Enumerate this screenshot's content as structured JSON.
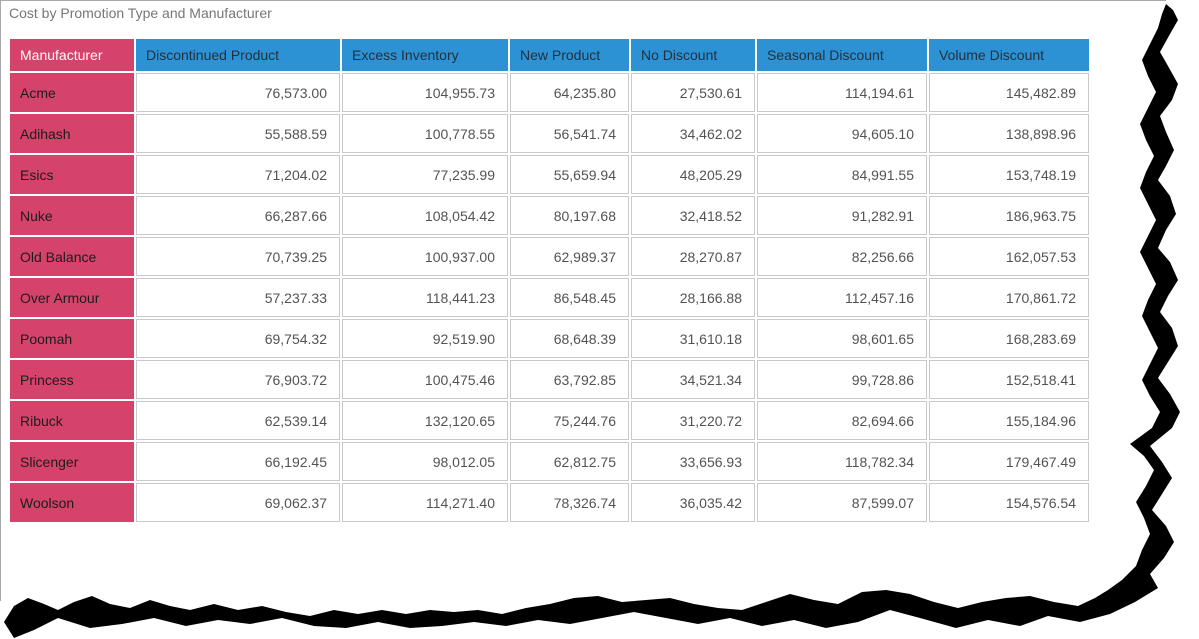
{
  "title": "Cost by Promotion Type and Manufacturer",
  "chart_data": {
    "type": "table",
    "title": "Cost by Promotion Type and Manufacturer",
    "row_header": "Manufacturer",
    "columns": [
      "Discontinued Product",
      "Excess Inventory",
      "New Product",
      "No Discount",
      "Seasonal Discount",
      "Volume Discount"
    ],
    "rows": [
      {
        "manufacturer": "Acme",
        "values": [
          "76,573.00",
          "104,955.73",
          "64,235.80",
          "27,530.61",
          "114,194.61",
          "145,482.89"
        ]
      },
      {
        "manufacturer": "Adihash",
        "values": [
          "55,588.59",
          "100,778.55",
          "56,541.74",
          "34,462.02",
          "94,605.10",
          "138,898.96"
        ]
      },
      {
        "manufacturer": "Esics",
        "values": [
          "71,204.02",
          "77,235.99",
          "55,659.94",
          "48,205.29",
          "84,991.55",
          "153,748.19"
        ]
      },
      {
        "manufacturer": "Nuke",
        "values": [
          "66,287.66",
          "108,054.42",
          "80,197.68",
          "32,418.52",
          "91,282.91",
          "186,963.75"
        ]
      },
      {
        "manufacturer": "Old Balance",
        "values": [
          "70,739.25",
          "100,937.00",
          "62,989.37",
          "28,270.87",
          "82,256.66",
          "162,057.53"
        ]
      },
      {
        "manufacturer": "Over Armour",
        "values": [
          "57,237.33",
          "118,441.23",
          "86,548.45",
          "28,166.88",
          "112,457.16",
          "170,861.72"
        ]
      },
      {
        "manufacturer": "Poomah",
        "values": [
          "69,754.32",
          "92,519.90",
          "68,648.39",
          "31,610.18",
          "98,601.65",
          "168,283.69"
        ]
      },
      {
        "manufacturer": "Princess",
        "values": [
          "76,903.72",
          "100,475.46",
          "63,792.85",
          "34,521.34",
          "99,728.86",
          "152,518.41"
        ]
      },
      {
        "manufacturer": "Ribuck",
        "values": [
          "62,539.14",
          "132,120.65",
          "75,244.76",
          "31,220.72",
          "82,694.66",
          "155,184.96"
        ]
      },
      {
        "manufacturer": "Slicenger",
        "values": [
          "66,192.45",
          "98,012.05",
          "62,812.75",
          "33,656.93",
          "118,782.34",
          "179,467.49"
        ]
      },
      {
        "manufacturer": "Woolson",
        "values": [
          "69,062.37",
          "114,271.40",
          "78,326.74",
          "36,035.42",
          "87,599.07",
          "154,576.54"
        ]
      }
    ]
  },
  "colors": {
    "header_blue": "#2D92D4",
    "row_header_pink": "#D5436A",
    "grid_border": "#C9C9C9",
    "title_text": "#767676"
  }
}
